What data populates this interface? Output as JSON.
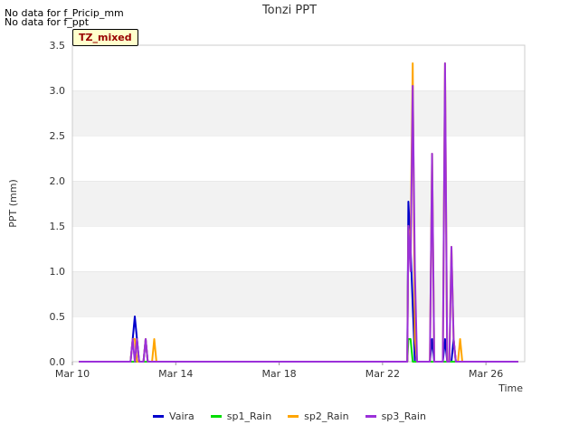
{
  "nodata": [
    "No data for f_Pricip_mm",
    "No data for f_ppt"
  ],
  "chart_data": {
    "type": "line",
    "title": "Tonzi PPT",
    "xlabel": "Time",
    "ylabel": "PPT (mm)",
    "annotation": "TZ_mixed",
    "xlim": [
      "2024-03-10",
      "2024-03-27T12:00"
    ],
    "ylim": [
      0,
      3.5
    ],
    "xticks": [
      {
        "date": "2024-03-10",
        "label": "Mar 10"
      },
      {
        "date": "2024-03-14",
        "label": "Mar 14"
      },
      {
        "date": "2024-03-18",
        "label": "Mar 18"
      },
      {
        "date": "2024-03-22",
        "label": "Mar 22"
      },
      {
        "date": "2024-03-26",
        "label": "Mar 26"
      }
    ],
    "yticks": [
      "0.0",
      "0.5",
      "1.0",
      "1.5",
      "2.0",
      "2.5",
      "3.0",
      "3.5"
    ],
    "grid": "horizontal-bands",
    "legend_position": "bottom-center",
    "series": [
      {
        "name": "Vaira",
        "color": "#0000cc",
        "points": [
          [
            "2024-03-10T06:00",
            0
          ],
          [
            "2024-03-12T06:00",
            0
          ],
          [
            "2024-03-12T08:00",
            0.25
          ],
          [
            "2024-03-12T10:00",
            0.5
          ],
          [
            "2024-03-12T12:00",
            0.25
          ],
          [
            "2024-03-12T14:00",
            0
          ],
          [
            "2024-03-12T18:00",
            0
          ],
          [
            "2024-03-12T20:00",
            0.25
          ],
          [
            "2024-03-12T22:00",
            0
          ],
          [
            "2024-03-22T23:00",
            0
          ],
          [
            "2024-03-23T00:00",
            1.77
          ],
          [
            "2024-03-23T02:00",
            1.27
          ],
          [
            "2024-03-23T06:00",
            0
          ],
          [
            "2024-03-23T20:00",
            0
          ],
          [
            "2024-03-23T22:00",
            0.25
          ],
          [
            "2024-03-24T00:00",
            0
          ],
          [
            "2024-03-24T08:00",
            0
          ],
          [
            "2024-03-24T10:00",
            0.25
          ],
          [
            "2024-03-24T12:00",
            0
          ],
          [
            "2024-03-24T16:00",
            0
          ],
          [
            "2024-03-24T18:00",
            0.25
          ],
          [
            "2024-03-24T20:00",
            0
          ],
          [
            "2024-03-27T06:00",
            0
          ]
        ]
      },
      {
        "name": "sp1_Rain",
        "color": "#00dd00",
        "points": [
          [
            "2024-03-10T06:00",
            0
          ],
          [
            "2024-03-22T23:00",
            0
          ],
          [
            "2024-03-23T00:00",
            0.25
          ],
          [
            "2024-03-23T02:00",
            0.25
          ],
          [
            "2024-03-23T04:00",
            0
          ],
          [
            "2024-03-27T06:00",
            0
          ]
        ]
      },
      {
        "name": "sp2_Rain",
        "color": "#ffa500",
        "points": [
          [
            "2024-03-10T06:00",
            0
          ],
          [
            "2024-03-12T06:00",
            0
          ],
          [
            "2024-03-12T08:00",
            0.25
          ],
          [
            "2024-03-12T10:00",
            0.25
          ],
          [
            "2024-03-12T12:00",
            0
          ],
          [
            "2024-03-12T18:00",
            0
          ],
          [
            "2024-03-12T20:00",
            0.25
          ],
          [
            "2024-03-12T22:00",
            0
          ],
          [
            "2024-03-13T02:00",
            0
          ],
          [
            "2024-03-13T04:00",
            0.25
          ],
          [
            "2024-03-13T06:00",
            0
          ],
          [
            "2024-03-22T23:00",
            0
          ],
          [
            "2024-03-23T00:00",
            1.5
          ],
          [
            "2024-03-23T02:00",
            1.27
          ],
          [
            "2024-03-23T04:00",
            3.3
          ],
          [
            "2024-03-23T06:00",
            0.25
          ],
          [
            "2024-03-23T08:00",
            0
          ],
          [
            "2024-03-23T20:00",
            0
          ],
          [
            "2024-03-23T22:00",
            2.3
          ],
          [
            "2024-03-24T00:00",
            0
          ],
          [
            "2024-03-24T08:00",
            0
          ],
          [
            "2024-03-24T10:00",
            3.3
          ],
          [
            "2024-03-24T12:00",
            0
          ],
          [
            "2024-03-24T14:00",
            0
          ],
          [
            "2024-03-24T16:00",
            1.27
          ],
          [
            "2024-03-24T18:00",
            0.25
          ],
          [
            "2024-03-24T20:00",
            0
          ],
          [
            "2024-03-24T22:00",
            0
          ],
          [
            "2024-03-25T00:00",
            0.25
          ],
          [
            "2024-03-25T02:00",
            0
          ],
          [
            "2024-03-27T06:00",
            0
          ]
        ]
      },
      {
        "name": "sp3_Rain",
        "color": "#9b30d9",
        "points": [
          [
            "2024-03-10T06:00",
            0
          ],
          [
            "2024-03-12T06:00",
            0
          ],
          [
            "2024-03-12T08:00",
            0.25
          ],
          [
            "2024-03-12T10:00",
            0
          ],
          [
            "2024-03-12T12:00",
            0.25
          ],
          [
            "2024-03-12T14:00",
            0
          ],
          [
            "2024-03-12T18:00",
            0
          ],
          [
            "2024-03-12T20:00",
            0.25
          ],
          [
            "2024-03-12T22:00",
            0
          ],
          [
            "2024-03-22T23:00",
            0
          ],
          [
            "2024-03-23T00:00",
            1.5
          ],
          [
            "2024-03-23T02:00",
            1.0
          ],
          [
            "2024-03-23T04:00",
            3.05
          ],
          [
            "2024-03-23T06:00",
            1.0
          ],
          [
            "2024-03-23T08:00",
            0
          ],
          [
            "2024-03-23T20:00",
            0
          ],
          [
            "2024-03-23T22:00",
            2.3
          ],
          [
            "2024-03-24T00:00",
            0
          ],
          [
            "2024-03-24T08:00",
            0
          ],
          [
            "2024-03-24T10:00",
            3.3
          ],
          [
            "2024-03-24T12:00",
            0
          ],
          [
            "2024-03-24T14:00",
            0
          ],
          [
            "2024-03-24T16:00",
            1.27
          ],
          [
            "2024-03-24T18:00",
            0.25
          ],
          [
            "2024-03-24T20:00",
            0
          ],
          [
            "2024-03-27T06:00",
            0
          ]
        ]
      }
    ]
  }
}
